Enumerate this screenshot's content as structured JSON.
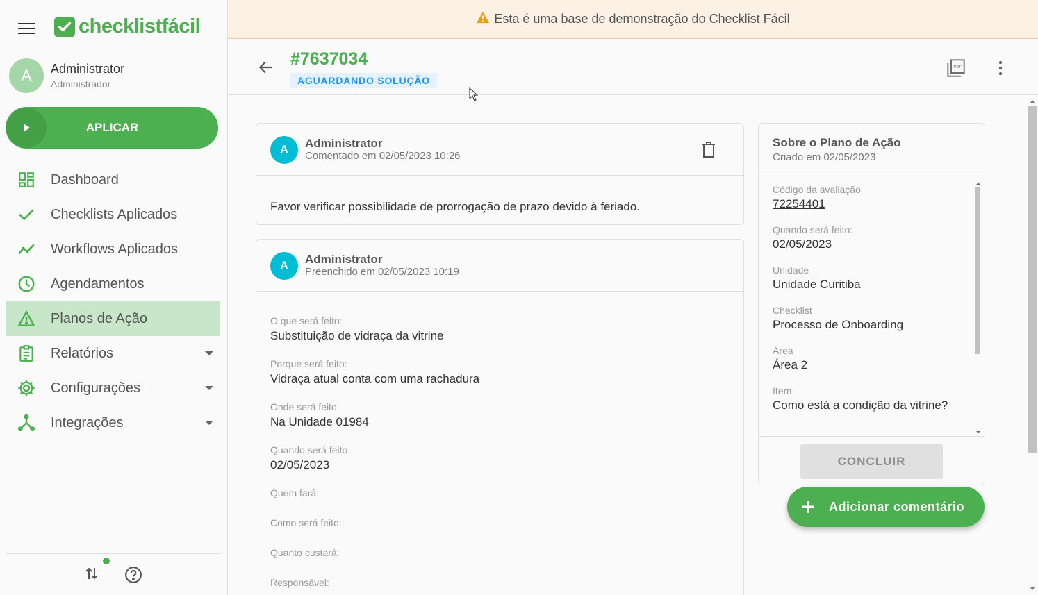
{
  "sidebar": {
    "brand": "checklistfácil",
    "user": {
      "avatar_initial": "A",
      "name": "Administrator",
      "role": "Administrador"
    },
    "apply_label": "APLICAR",
    "items": [
      {
        "label": "Dashboard",
        "icon": "dashboard-icon"
      },
      {
        "label": "Checklists Aplicados",
        "icon": "check-icon"
      },
      {
        "label": "Workflows Aplicados",
        "icon": "trend-icon"
      },
      {
        "label": "Agendamentos",
        "icon": "clock-icon"
      },
      {
        "label": "Planos de Ação",
        "icon": "warning-icon",
        "active": true
      },
      {
        "label": "Relatórios",
        "icon": "clipboard-icon",
        "expandable": true
      },
      {
        "label": "Configurações",
        "icon": "gear-icon",
        "expandable": true
      },
      {
        "label": "Integrações",
        "icon": "integration-icon",
        "expandable": true
      }
    ]
  },
  "banner": {
    "text": "Esta é uma base de demonstração do Checklist Fácil"
  },
  "header": {
    "code": "#7637034",
    "status": "AGUARDANDO SOLUÇÃO"
  },
  "comment": {
    "author_initial": "A",
    "author": "Administrator",
    "subtitle": "Comentado em 02/05/2023 10:26",
    "text": "Favor verificar possibilidade de prorrogação de prazo devido à feriado."
  },
  "plan": {
    "author_initial": "A",
    "author": "Administrator",
    "subtitle": "Preenchido em 02/05/2023 10:19",
    "fields": [
      {
        "label": "O que será feito:",
        "value": "Substituição de vidraça da vitrine"
      },
      {
        "label": "Porque será feito:",
        "value": "Vidraça atual conta com uma rachadura"
      },
      {
        "label": "Onde será feito:",
        "value": "Na Unidade 01984"
      },
      {
        "label": "Quando será feito:",
        "value": "02/05/2023"
      },
      {
        "label": "Quem fará:",
        "value": ""
      },
      {
        "label": "Como será feito:",
        "value": ""
      },
      {
        "label": "Quanto custará:",
        "value": ""
      },
      {
        "label": "Responsável:",
        "value": ""
      }
    ]
  },
  "about": {
    "title": "Sobre o Plano de Ação",
    "subtitle": "Criado em 02/05/2023",
    "eval_label": "Código da avaliação",
    "eval_code": "72254401",
    "fields": [
      {
        "label": "Quando será feito:",
        "value": "02/05/2023"
      },
      {
        "label": "Unidade",
        "value": "Unidade Curitiba"
      },
      {
        "label": "Checklist",
        "value": "Processo de Onboarding"
      },
      {
        "label": "Área",
        "value": "Área 2"
      },
      {
        "label": "Item",
        "value": "Como está a condição da vitrine?"
      }
    ],
    "conclude_label": "CONCLUIR"
  },
  "fab_label": "Adicionar comentário",
  "colors": {
    "brand": "#4caf50",
    "status": "#2196f3",
    "avatar": "#00bcd4"
  }
}
